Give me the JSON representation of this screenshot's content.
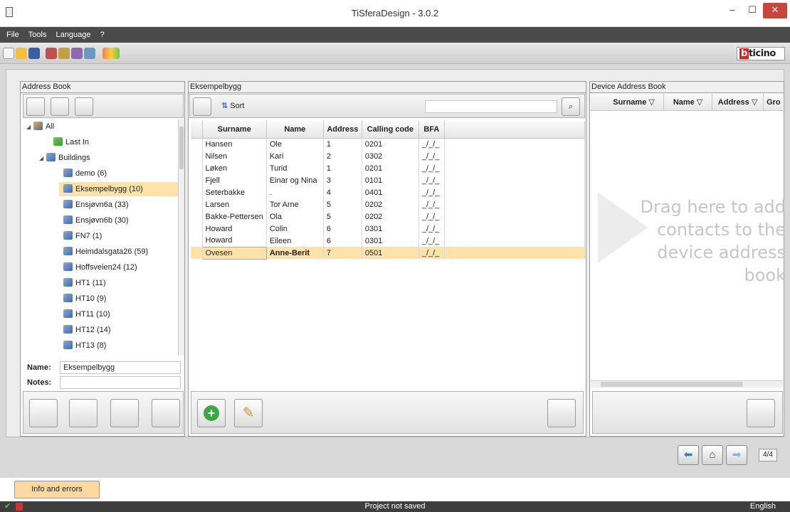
{
  "window": {
    "title": "TiSferaDesign - 3.0.2",
    "min": "–",
    "max": "☐",
    "close": "✕"
  },
  "menu": [
    "File",
    "Tools",
    "Language",
    "?"
  ],
  "brand": {
    "logo_first": "b",
    "logo_rest": "ticino"
  },
  "address_book": {
    "title": "Address Book",
    "tree": [
      {
        "label": "All",
        "level": 0,
        "expanded": true
      },
      {
        "label": "Last In",
        "level": 2
      },
      {
        "label": "Buildings",
        "level": 1,
        "expanded": true
      },
      {
        "label": "demo (6)",
        "level": 2
      },
      {
        "label": "Eksempelbygg (10)",
        "level": 2,
        "selected": true
      },
      {
        "label": "Ensjøvn6a (33)",
        "level": 2
      },
      {
        "label": "Ensjøvn6b (30)",
        "level": 2
      },
      {
        "label": "FN7 (1)",
        "level": 2
      },
      {
        "label": "Heimdalsgata26 (59)",
        "level": 2
      },
      {
        "label": "Hoffsveien24 (12)",
        "level": 2
      },
      {
        "label": "HT1 (11)",
        "level": 2
      },
      {
        "label": "HT10 (9)",
        "level": 2
      },
      {
        "label": "HT11 (10)",
        "level": 2
      },
      {
        "label": "HT12 (14)",
        "level": 2
      },
      {
        "label": "HT13 (8)",
        "level": 2
      }
    ],
    "name_label": "Name:",
    "name_value": "Eksempelbygg",
    "notes_label": "Notes:",
    "notes_value": ""
  },
  "building": {
    "title": "Eksempelbygg",
    "sort_label": "Sort",
    "search_value": "",
    "columns": [
      "Surname",
      "Name",
      "Address",
      "Calling code",
      "BFA"
    ],
    "rows": [
      [
        "Hansen",
        "Ole",
        "1",
        "0201",
        "_/_/_"
      ],
      [
        "Nilsen",
        "Kari",
        "2",
        "0302",
        "_/_/_"
      ],
      [
        "Løken",
        "Turid",
        "1",
        "0201",
        "_/_/_"
      ],
      [
        "Fjell",
        "Einar og Nina",
        "3",
        "0101",
        "_/_/_"
      ],
      [
        "Seterbakke",
        ".",
        "4",
        "0401",
        "_/_/_"
      ],
      [
        "Larsen",
        "Tor Arne",
        "5",
        "0202",
        "_/_/_"
      ],
      [
        "Bakke-Pettersen",
        "Ola",
        "5",
        "0202",
        "_/_/_"
      ],
      [
        "Howard",
        "Colin",
        "6",
        "0301",
        "_/_/_"
      ],
      [
        "Howard",
        "Eileen",
        "6",
        "0301",
        "_/_/_"
      ],
      [
        "Ovesen",
        "Anne-Berit",
        "7",
        "0501",
        "_/_/_"
      ]
    ],
    "selected_row": 9
  },
  "device": {
    "title": "Device Address Book",
    "columns": [
      "Surname",
      "Name",
      "Address",
      "Gro"
    ],
    "filter_icon": "▽",
    "drag_hint": "Drag here to add contacts to the device address book"
  },
  "nav": {
    "page": "4/4"
  },
  "info_tab": "Info and errors",
  "status": {
    "message": "Project not saved",
    "language": "English"
  }
}
